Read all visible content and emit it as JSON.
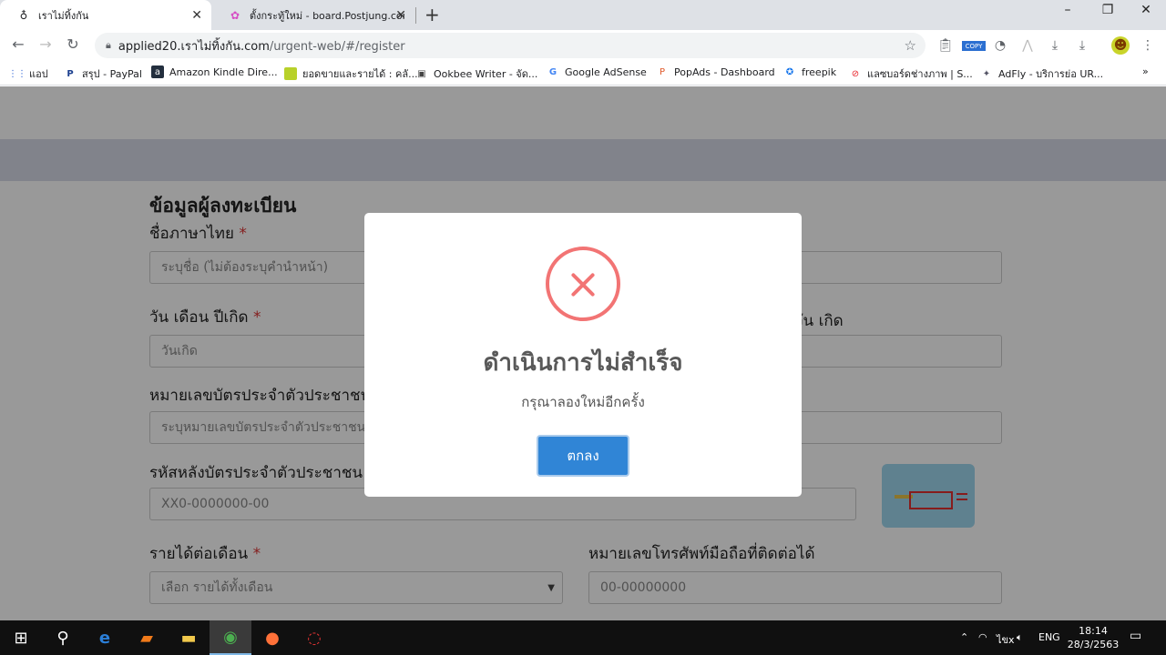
{
  "browser": {
    "tabs": [
      {
        "label": "เราไม่ทิ้งกัน",
        "active": true
      },
      {
        "label": "ตั้งกระทู้ใหม่ - board.Postjung.com",
        "active": false
      }
    ],
    "new_tab_icon": "+",
    "window_controls": {
      "minimize": "–",
      "restore": "❐",
      "close": "✕"
    },
    "url": {
      "host": "applied20.เราไม่ทิ้งกัน.com",
      "path": "/urgent-web/#/register"
    },
    "extensions": {
      "copy_badge": "COPY"
    }
  },
  "bookmarks": [
    {
      "label": "แอป",
      "icon": "apps-grid-icon"
    },
    {
      "label": "สรุป - PayPal",
      "icon": "paypal-icon"
    },
    {
      "label": "Amazon Kindle Dire...",
      "icon": "kindle-icon"
    },
    {
      "label": "ยอดขายและรายได้ : คลั...",
      "icon": "folder-icon"
    },
    {
      "label": "Ookbee Writer - จัด...",
      "icon": "ookbee-icon"
    },
    {
      "label": "Google AdSense",
      "icon": "google-icon"
    },
    {
      "label": "PopAds - Dashboard",
      "icon": "popads-icon"
    },
    {
      "label": "freepik",
      "icon": "freepik-icon"
    },
    {
      "label": "แลซบอร์ดช่างภาพ | S...",
      "icon": "shutterstock-icon"
    },
    {
      "label": "AdFly - บริการย่อ UR...",
      "icon": "adfly-icon"
    }
  ],
  "form": {
    "title": "ข้อมูลผู้ลงทะเบียน",
    "thai_name_label": "ชื่อภาษาไทย",
    "thai_name_placeholder": "ระบุชื่อ (ไม่ต้องระบุคำนำหน้า)",
    "birthdate_label": "วัน เดือน ปีเกิด",
    "birthdate_placeholder": "วันเกิด",
    "birthdate_right_label": "วัน เกิด",
    "id_label": "หมายเลขบัตรประจำตัวประชาชน",
    "id_placeholder": "ระบุหมายเลขบัตรประจำตัวประชาชน",
    "laser_label": "รหัสหลังบัตรประจำตัวประชาชน",
    "laser_placeholder": "XX0-0000000-00",
    "income_label": "รายได้ต่อเดือน",
    "income_placeholder": "เลือก รายได้ทั้งเดือน",
    "phone_label": "หมายเลขโทรศัพท์มือถือที่ติดต่อได้",
    "phone_placeholder": "00-00000000",
    "required_mark": "*"
  },
  "modal": {
    "title": "ดำเนินการไม่สำเร็จ",
    "message": "กรุณาลองใหม่อีกครั้ง",
    "ok_label": "ตกลง",
    "colors": {
      "error": "#f27474",
      "button": "#3085d6"
    }
  },
  "taskbar": {
    "language": "ENG",
    "time": "18:14",
    "date": "28/3/2563",
    "thai_input": "ไขx"
  }
}
